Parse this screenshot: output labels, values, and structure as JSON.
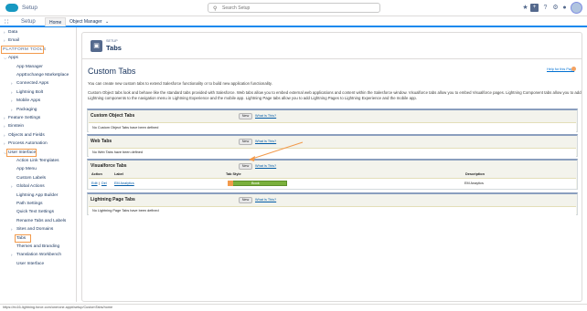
{
  "header": {
    "app_name": "Setup",
    "search_placeholder": "Search Setup",
    "icons": [
      "star-icon",
      "add-icon",
      "help-icon",
      "gear-icon",
      "bell-icon",
      "avatar"
    ]
  },
  "nav": {
    "app_name": "Setup",
    "tabs": [
      "Home",
      "Object Manager"
    ]
  },
  "sidebar": {
    "items": [
      {
        "label": "Data",
        "chevron": true
      },
      {
        "label": "Email",
        "chevron": true
      },
      {
        "label": "PLATFORM TOOLS",
        "heading": true
      },
      {
        "label": "Apps",
        "chevron": true,
        "expanded": true
      },
      {
        "label": "App Manager"
      },
      {
        "label": "AppExchange Marketplace"
      },
      {
        "label": "Connected Apps",
        "chevron": true
      },
      {
        "label": "Lightning Bolt",
        "chevron": true
      },
      {
        "label": "Mobile Apps",
        "chevron": true
      },
      {
        "label": "Packaging",
        "chevron": true
      },
      {
        "label": "Feature Settings",
        "chevron": true
      },
      {
        "label": "Einstein",
        "chevron": true
      },
      {
        "label": "Objects and Fields",
        "chevron": true
      },
      {
        "label": "Process Automation",
        "chevron": true
      },
      {
        "label": "User Interface",
        "chevron": true,
        "expanded": true
      },
      {
        "label": "Action Link Templates"
      },
      {
        "label": "App Menu"
      },
      {
        "label": "Custom Labels"
      },
      {
        "label": "Global Actions",
        "chevron": true
      },
      {
        "label": "Lightning App Builder"
      },
      {
        "label": "Path Settings"
      },
      {
        "label": "Quick Text Settings"
      },
      {
        "label": "Rename Tabs and Labels"
      },
      {
        "label": "Sites and Domains",
        "chevron": true
      },
      {
        "label": "Tabs"
      },
      {
        "label": "Themes and Branding"
      },
      {
        "label": "Translation Workbench",
        "chevron": true
      },
      {
        "label": "User Interface"
      }
    ],
    "highlight_color": "#f29a4b"
  },
  "page_header": {
    "sup": "SETUP",
    "title": "Tabs"
  },
  "main": {
    "title": "Custom Tabs",
    "help_link": "Help for this Page",
    "intro": "You can create new custom tabs to extend Salesforce functionality or to build new application functionality.",
    "desc_1": "Custom Object tabs look and behave like the standard tabs provided with Salesforce. Web tabs allow you to embed external web applications and content within the Salesforce window. Visualforce tabs allow you to embed Visualforce pages. Lightning Component tabs allow you to add",
    "desc_2": "Lightning components to the navigation menu in Lightning Experience and the mobile app. Lightning Page tabs allow you to add Lightning Pages to Lightning Experience and the mobile app.",
    "new_label": "New",
    "what_label": "What Is This?",
    "sections": [
      {
        "title": "Custom Object Tabs",
        "empty": "No Custom Object Tabs have been defined"
      },
      {
        "title": "Web Tabs",
        "empty": "No Web Tabs have been defined"
      },
      {
        "title": "Visualforce Tabs",
        "columns": [
          "Action",
          "Label",
          "Tab Style",
          "Description"
        ],
        "row": {
          "edit": "Edit",
          "del": "Del",
          "label": "EM Analytics",
          "style": "Book",
          "description": "EM Anaytics"
        }
      },
      {
        "title": "Lightning Page Tabs",
        "empty": "No Lightning Page Tabs have been defined"
      }
    ]
  },
  "status_url": "https://ec16-lightning.force.com/one/one.app#/setup/CustomTabs/home",
  "colors": {
    "accent": "#1589ee",
    "annotation": "#f29a4b",
    "tab_style": "#7ab03d"
  }
}
